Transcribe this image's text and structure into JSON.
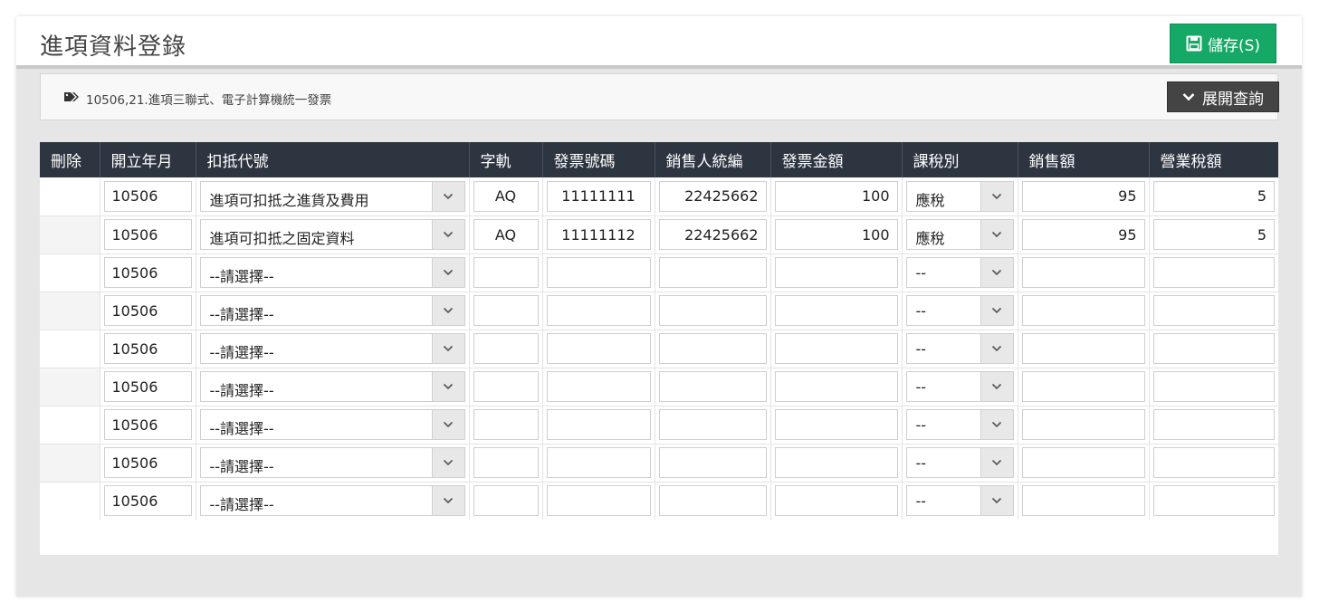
{
  "header": {
    "title": "進項資料登錄",
    "save_label": "儲存(S)"
  },
  "info": {
    "text": "10506,21.進項三聯式、電子計算機統一發票",
    "expand_label": "展開查詢"
  },
  "table": {
    "columns": [
      "刪除",
      "開立年月",
      "扣抵代號",
      "字軌",
      "發票號碼",
      "銷售人統編",
      "發票金額",
      "課稅別",
      "銷售額",
      "營業稅額"
    ],
    "rows": [
      {
        "month": "10506",
        "code": "進項可扣抵之進貨及費用",
        "track": "AQ",
        "invoice_no": "11111111",
        "seller_id": "22425662",
        "amount": "100",
        "tax_type": "應稅",
        "sales": "95",
        "tax": "5"
      },
      {
        "month": "10506",
        "code": "進項可扣抵之固定資料",
        "track": "AQ",
        "invoice_no": "11111112",
        "seller_id": "22425662",
        "amount": "100",
        "tax_type": "應稅",
        "sales": "95",
        "tax": "5"
      },
      {
        "month": "10506",
        "code": "--請選擇--",
        "track": "",
        "invoice_no": "",
        "seller_id": "",
        "amount": "",
        "tax_type": "--",
        "sales": "",
        "tax": ""
      },
      {
        "month": "10506",
        "code": "--請選擇--",
        "track": "",
        "invoice_no": "",
        "seller_id": "",
        "amount": "",
        "tax_type": "--",
        "sales": "",
        "tax": ""
      },
      {
        "month": "10506",
        "code": "--請選擇--",
        "track": "",
        "invoice_no": "",
        "seller_id": "",
        "amount": "",
        "tax_type": "--",
        "sales": "",
        "tax": ""
      },
      {
        "month": "10506",
        "code": "--請選擇--",
        "track": "",
        "invoice_no": "",
        "seller_id": "",
        "amount": "",
        "tax_type": "--",
        "sales": "",
        "tax": ""
      },
      {
        "month": "10506",
        "code": "--請選擇--",
        "track": "",
        "invoice_no": "",
        "seller_id": "",
        "amount": "",
        "tax_type": "--",
        "sales": "",
        "tax": ""
      },
      {
        "month": "10506",
        "code": "--請選擇--",
        "track": "",
        "invoice_no": "",
        "seller_id": "",
        "amount": "",
        "tax_type": "--",
        "sales": "",
        "tax": ""
      },
      {
        "month": "10506",
        "code": "--請選擇--",
        "track": "",
        "invoice_no": "",
        "seller_id": "",
        "amount": "",
        "tax_type": "--",
        "sales": "",
        "tax": ""
      }
    ]
  },
  "colors": {
    "save_button": "#16a866",
    "table_header": "#2d3540",
    "expand_button": "#444444"
  }
}
